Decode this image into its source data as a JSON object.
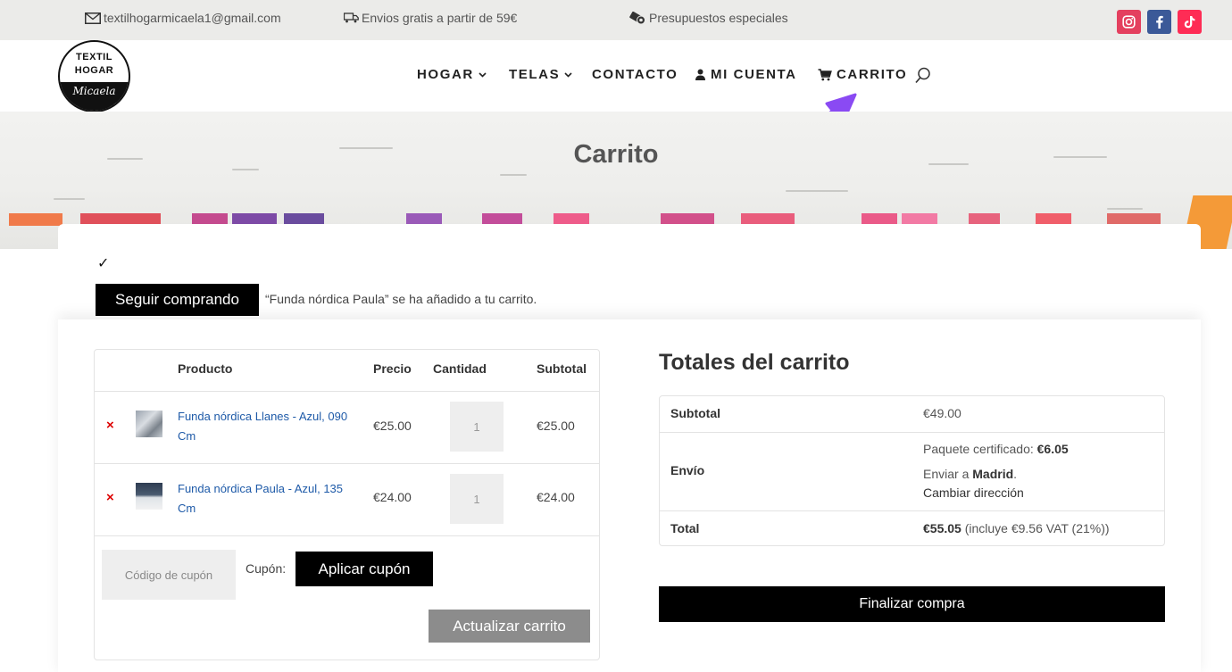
{
  "topbar": {
    "email": "textilhogarmicaela1@gmail.com",
    "shipping": "Envios gratis a partir de 59€",
    "quotes": "Presupuestos especiales",
    "social": [
      "instagram-icon",
      "facebook-icon",
      "tiktok-icon"
    ],
    "colors": {
      "instagram": "#e4405f",
      "facebook": "#3b5998",
      "tiktok": "#fe2c55"
    }
  },
  "logo": {
    "line1": "TEXTIL",
    "line2": "HOGAR",
    "line3": "Micaela"
  },
  "nav": {
    "items": [
      {
        "label": "HOGAR",
        "has_dropdown": true
      },
      {
        "label": "TELAS",
        "has_dropdown": true
      },
      {
        "label": "CONTACTO",
        "has_dropdown": false
      },
      {
        "label": "MI CUENTA",
        "icon": "user-icon"
      },
      {
        "label": "CARRITO",
        "icon": "cart-icon"
      }
    ],
    "search_icon": "search-icon"
  },
  "hero": {
    "title": "Carrito"
  },
  "notice": {
    "check": "✓",
    "continue_label": "Seguir comprando",
    "message": "“Funda nórdica Paula” se ha añadido a tu carrito."
  },
  "cart": {
    "headers": {
      "product": "Producto",
      "price": "Precio",
      "quantity": "Cantidad",
      "subtotal": "Subtotal"
    },
    "items": [
      {
        "remove": "×",
        "name": "Funda nórdica Llanes - Azul, 090 Cm",
        "price": "€25.00",
        "quantity": "1",
        "subtotal": "€25.00"
      },
      {
        "remove": "×",
        "name": "Funda nórdica Paula - Azul, 135 Cm",
        "price": "€24.00",
        "quantity": "1",
        "subtotal": "€24.00"
      }
    ],
    "coupon_placeholder": "Código de cupón",
    "coupon_label": "Cupón:",
    "apply_coupon_label": "Aplicar cupón",
    "update_cart_label": "Actualizar carrito"
  },
  "totals": {
    "title": "Totales del carrito",
    "subtotal_label": "Subtotal",
    "subtotal_value": "€49.00",
    "shipping_label": "Envío",
    "shipping_method": "Paquete certificado: ",
    "shipping_price": "€6.05",
    "ship_to_prefix": "Enviar a ",
    "ship_to_city": "Madrid",
    "ship_to_suffix": ".",
    "change_address": "Cambiar dirección",
    "total_label": "Total",
    "total_value": "€55.05",
    "total_note": " (incluye €9.56 VAT (21%))",
    "checkout_label": "Finalizar compra"
  },
  "annotation": {
    "arrow_color": "#8a4af3"
  }
}
